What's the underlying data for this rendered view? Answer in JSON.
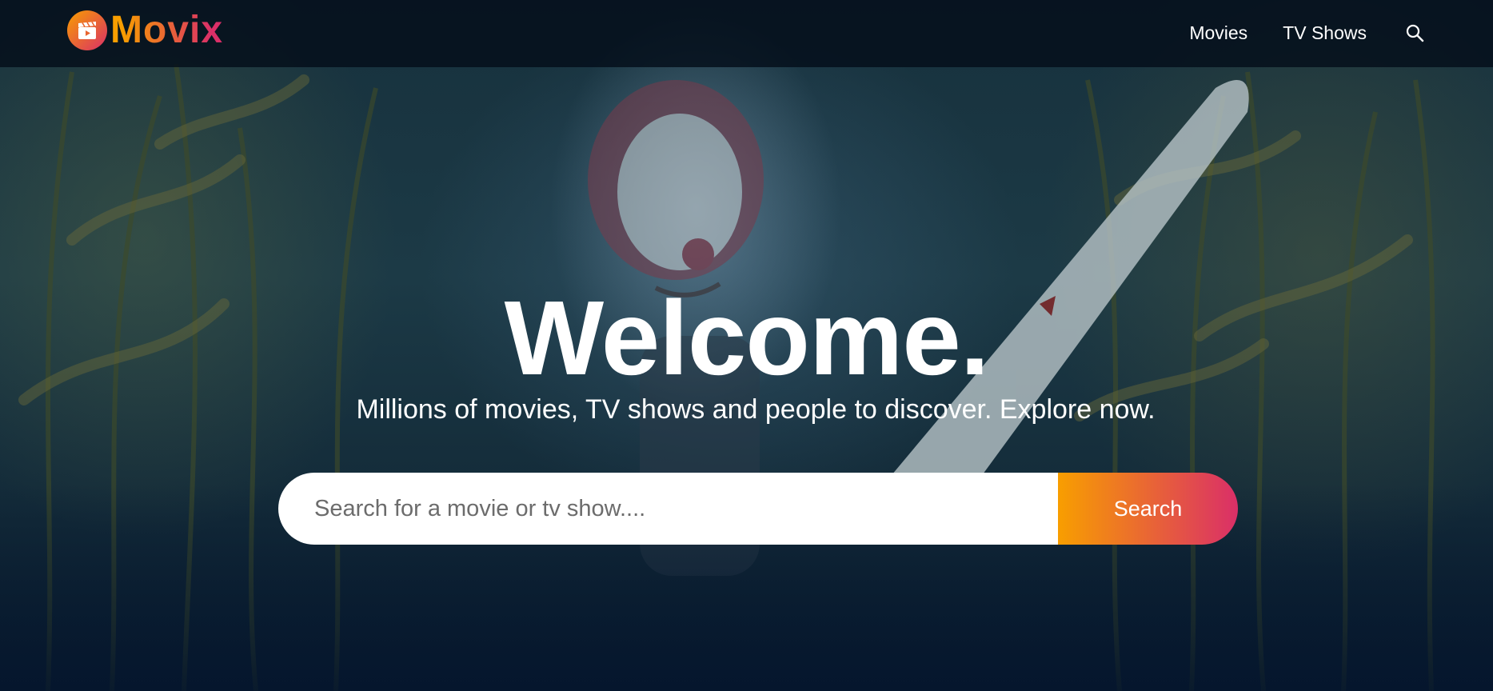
{
  "brand": {
    "name": "Movix",
    "logo_icon": "clapperboard-icon",
    "gradient": [
      "#f89e00",
      "#da2f68"
    ]
  },
  "nav": {
    "items": [
      {
        "label": "Movies"
      },
      {
        "label": "TV Shows"
      }
    ],
    "search_icon": "search-icon"
  },
  "hero": {
    "title": "Welcome.",
    "subtitle": "Millions of movies, TV shows and people to discover. Explore now.",
    "search": {
      "placeholder": "Search for a movie or tv show....",
      "value": "",
      "button_label": "Search"
    }
  },
  "colors": {
    "background": "#04152d",
    "text": "#ffffff"
  }
}
